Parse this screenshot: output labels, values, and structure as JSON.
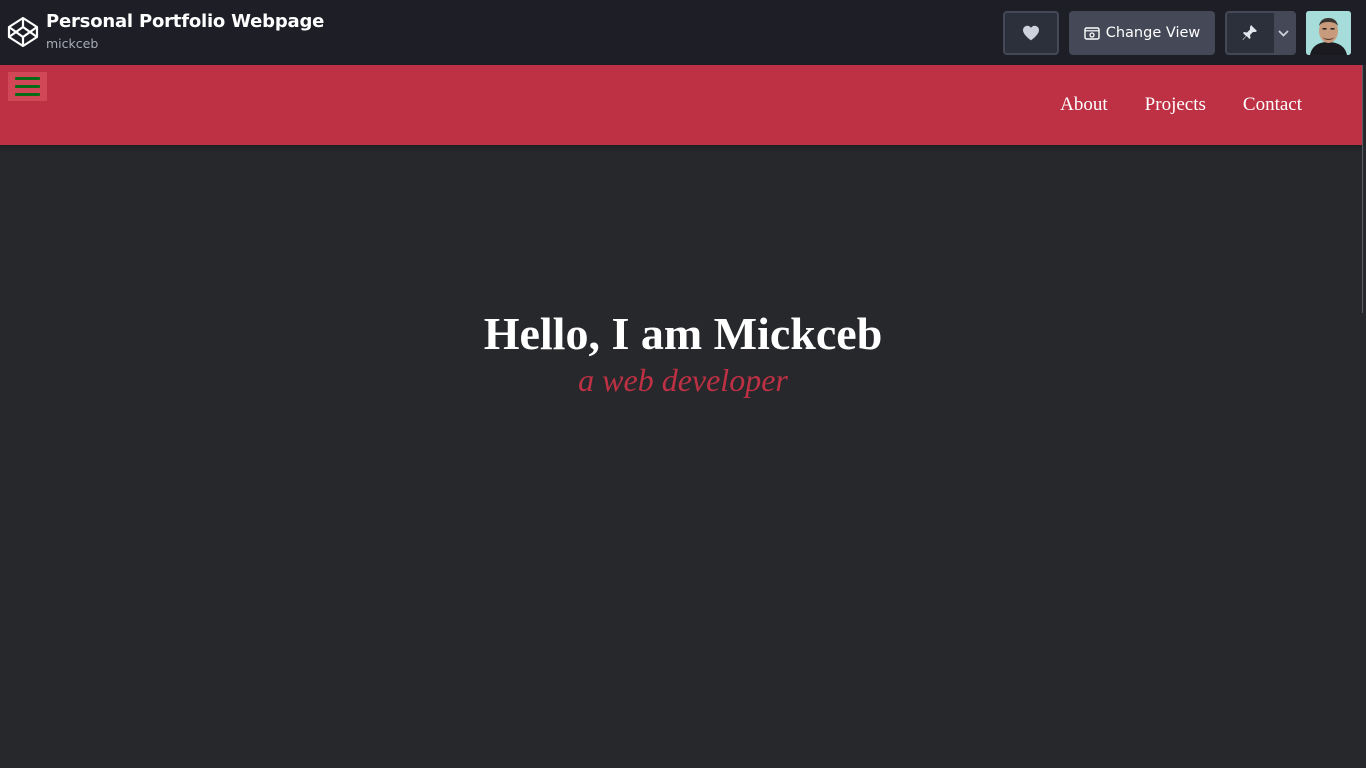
{
  "codepen_header": {
    "pen_title": "Personal Portfolio Webpage",
    "author": "mickceb",
    "change_view_label": "Change View",
    "icons": [
      "codepen-logo-icon",
      "heart-icon",
      "view-icon",
      "pin-icon",
      "chevron-down-icon"
    ]
  },
  "nav": {
    "items": [
      {
        "label": "About"
      },
      {
        "label": "Projects"
      },
      {
        "label": "Contact"
      }
    ]
  },
  "hero": {
    "heading": "Hello, I am Mickceb",
    "subheading": "a web developer"
  },
  "colors": {
    "topbar_bg": "#1e1f26",
    "nav_bg": "#be3144",
    "page_bg": "#27282c",
    "accent": "#be3144",
    "hamburger_lines": "#0a6b17"
  }
}
